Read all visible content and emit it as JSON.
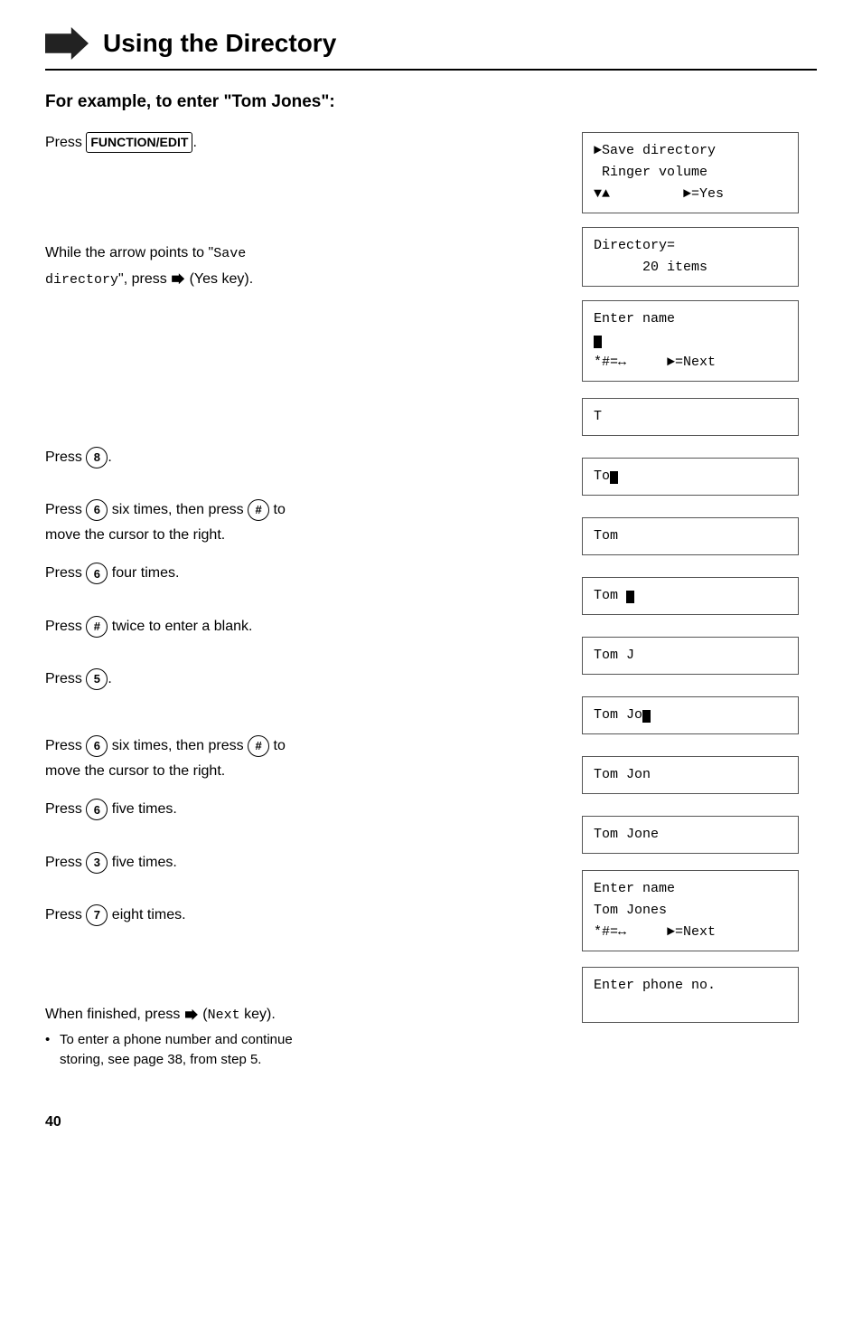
{
  "header": {
    "title": "Using the Directory",
    "arrow_icon": "arrow-right"
  },
  "section_heading": "For example, to enter \"Tom Jones\":",
  "steps": [
    {
      "id": "step1",
      "text_parts": [
        "Press ",
        "FUNCTION/EDIT",
        "."
      ],
      "key_type": "box",
      "key_label": "FUNCTION/EDIT"
    },
    {
      "id": "step2",
      "text_parts": [
        "While the arrow points to “Save directory”, press ",
        "►",
        " (Yes key)."
      ],
      "note": "Save directory"
    },
    {
      "id": "step3",
      "text_parts": [
        "Press ",
        "8",
        "."
      ],
      "key_type": "circle",
      "key_label": "8"
    },
    {
      "id": "step4",
      "text_parts": [
        "Press ",
        "6",
        " six times, then press ",
        "#",
        " to move the cursor to the right."
      ],
      "keys": [
        [
          "circle",
          "6"
        ],
        [
          "circle",
          "#"
        ]
      ]
    },
    {
      "id": "step5",
      "text_parts": [
        "Press ",
        "6",
        " four times."
      ],
      "key_type": "circle",
      "key_label": "6"
    },
    {
      "id": "step6",
      "text_parts": [
        "Press ",
        "#",
        " twice to enter a blank."
      ],
      "key_type": "circle",
      "key_label": "#"
    },
    {
      "id": "step7",
      "text_parts": [
        "Press ",
        "5",
        "."
      ],
      "key_type": "circle",
      "key_label": "5"
    },
    {
      "id": "step8",
      "text_parts": [
        "Press ",
        "6",
        " six times, then press ",
        "#",
        " to move the cursor to the right."
      ],
      "keys": [
        [
          "circle",
          "6"
        ],
        [
          "circle",
          "#"
        ]
      ]
    },
    {
      "id": "step9",
      "text_parts": [
        "Press ",
        "6",
        " five times."
      ],
      "key_type": "circle",
      "key_label": "6"
    },
    {
      "id": "step10",
      "text_parts": [
        "Press ",
        "3",
        " five times."
      ],
      "key_type": "circle",
      "key_label": "3"
    },
    {
      "id": "step11",
      "text_parts": [
        "Press ",
        "7",
        " eight times."
      ],
      "key_type": "circle",
      "key_label": "7"
    },
    {
      "id": "step12",
      "text_parts": [
        "When finished, press ",
        "►",
        " (",
        "Next",
        " key)."
      ],
      "bullets": [
        "To enter a phone number and continue storing, see page 38, from step 5."
      ]
    }
  ],
  "lcd_screens": [
    {
      "id": "lcd1",
      "lines": [
        "►Save directory",
        " Ringer volume",
        "▼▲           ►=Yes"
      ],
      "type": "multi"
    },
    {
      "id": "lcd2",
      "lines": [
        "Directory=",
        "     20 items"
      ],
      "type": "multi"
    },
    {
      "id": "lcd3",
      "lines": [
        "Enter name",
        "■",
        "*#=←→       ►=Next"
      ],
      "type": "multi"
    },
    {
      "id": "lcd4",
      "lines": [
        "T"
      ],
      "type": "single"
    },
    {
      "id": "lcd5",
      "lines": [
        "To■"
      ],
      "type": "single"
    },
    {
      "id": "lcd6",
      "lines": [
        "Tom"
      ],
      "type": "single"
    },
    {
      "id": "lcd7",
      "lines": [
        "Tom ■"
      ],
      "type": "single"
    },
    {
      "id": "lcd8",
      "lines": [
        "Tom J"
      ],
      "type": "single"
    },
    {
      "id": "lcd9",
      "lines": [
        "Tom Jo■"
      ],
      "type": "single"
    },
    {
      "id": "lcd10",
      "lines": [
        "Tom Jon"
      ],
      "type": "single"
    },
    {
      "id": "lcd11",
      "lines": [
        "Tom Jone"
      ],
      "type": "single"
    },
    {
      "id": "lcd12",
      "lines": [
        "Enter name",
        "Tom Jones",
        "*#=←→       ►=Next"
      ],
      "type": "multi"
    },
    {
      "id": "lcd13",
      "lines": [
        "Enter phone no."
      ],
      "type": "multi"
    }
  ],
  "page_number": "40"
}
